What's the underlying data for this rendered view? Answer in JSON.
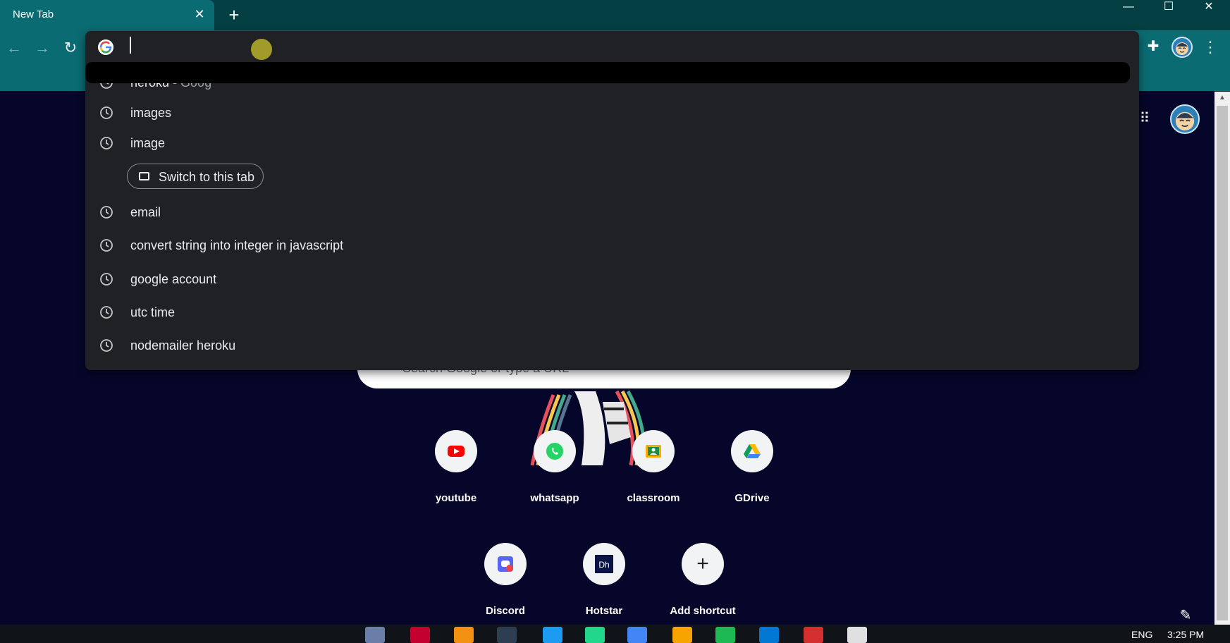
{
  "window": {
    "tab_title": "New Tab",
    "tab_close": "✕",
    "new_tab": "+",
    "minimize": "—",
    "maximize": "☐",
    "close": "✕"
  },
  "toolbar": {
    "back_icon": "arrow-left",
    "forward_icon": "arrow-right",
    "reload_icon": "reload",
    "extensions_icon": "puzzle",
    "menu_icon": "kebab"
  },
  "omnibox": {
    "value": "",
    "suggestions": [
      {
        "text": "heroku",
        "suffix": " - Goog"
      },
      {
        "text": "images"
      },
      {
        "text": "image"
      },
      {
        "text": "email"
      },
      {
        "text": "convert string into integer in javascript"
      },
      {
        "text": "google account"
      },
      {
        "text": "utc time"
      },
      {
        "text": "nodemailer heroku"
      }
    ],
    "switch_tab_label": "Switch to this tab"
  },
  "page": {
    "search_placeholder": "Search Google or type a URL",
    "shortcuts": [
      {
        "label": "youtube"
      },
      {
        "label": "whatsapp"
      },
      {
        "label": "classroom"
      },
      {
        "label": "GDrive"
      },
      {
        "label": "Discord"
      },
      {
        "label": "Hotstar"
      },
      {
        "label": "Add shortcut"
      }
    ]
  },
  "taskbar": {
    "language": "ENG",
    "time": "3:25 PM"
  },
  "colors": {
    "accent": "#0b6b72",
    "dropdown_bg": "#202124",
    "page_bg": "#06062a"
  }
}
